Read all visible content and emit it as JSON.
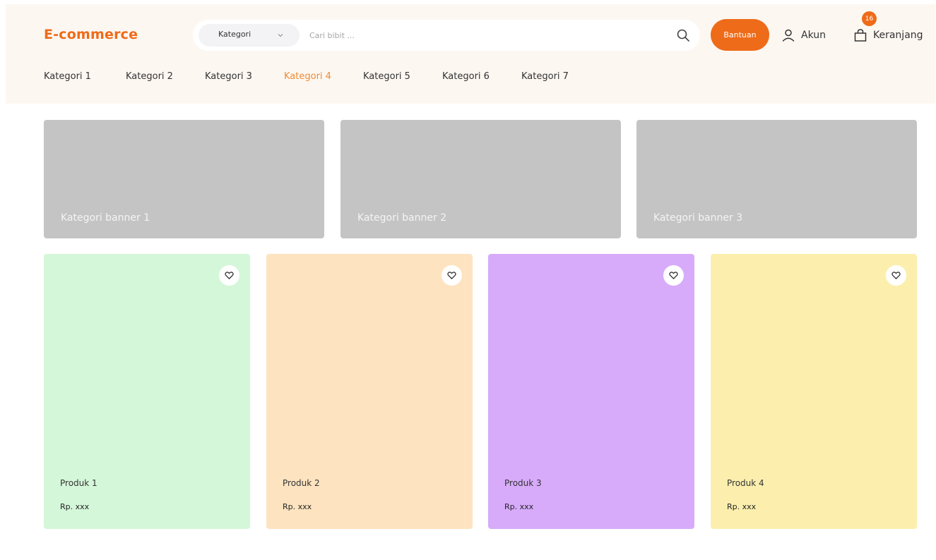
{
  "header": {
    "logo": "E-commerce",
    "search": {
      "category_label": "Kategori",
      "placeholder": "Cari bibit ..."
    },
    "help_label": "Bantuan",
    "account_label": "Akun",
    "cart_label": "Keranjang",
    "cart_count": "16",
    "accent_color": "#ee6b19"
  },
  "nav": {
    "items": [
      "Kategori 1",
      "Kategori 2",
      "Kategori 3",
      "Kategori 4",
      "Kategori 5",
      "Kategori 6",
      "Kategori 7"
    ],
    "active": "Kategori 4"
  },
  "banners": [
    {
      "label": "Kategori banner 1"
    },
    {
      "label": "Kategori banner 2"
    },
    {
      "label": "Kategori banner 3"
    }
  ],
  "products": [
    {
      "name": "Produk 1",
      "price": "Rp. xxx",
      "color": "#d4f7d9"
    },
    {
      "name": "Produk 2",
      "price": "Rp. xxx",
      "color": "#fde3c0"
    },
    {
      "name": "Produk 3",
      "price": "Rp. xxx",
      "color": "#d7abfa"
    },
    {
      "name": "Produk 4",
      "price": "Rp. xxx",
      "color": "#fcefae"
    }
  ]
}
